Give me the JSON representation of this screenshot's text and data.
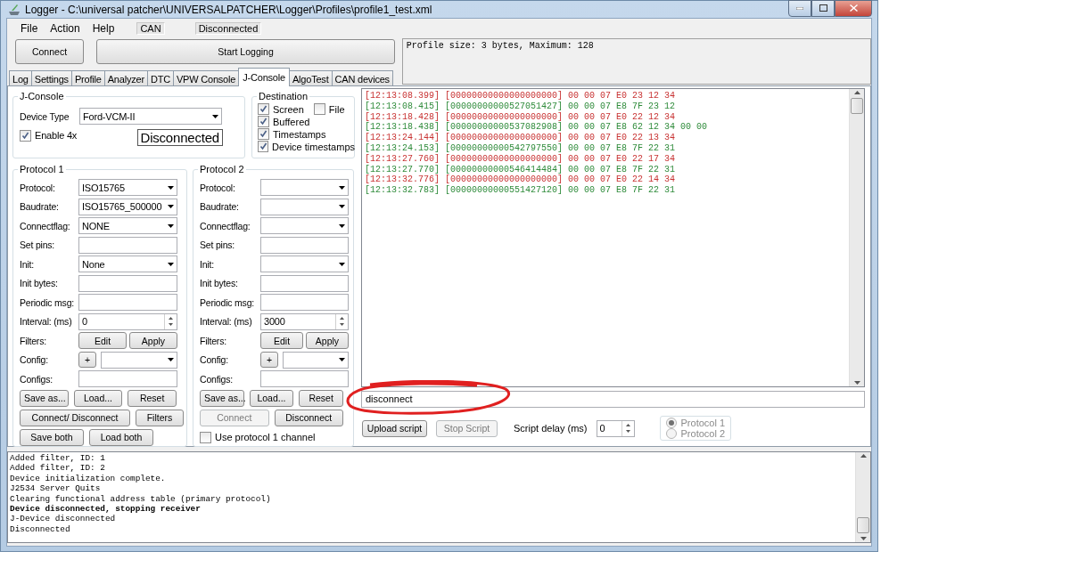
{
  "window": {
    "title": "Logger - C:\\universal patcher\\UNIVERSALPATCHER\\Logger\\Profiles\\profile1_test.xml"
  },
  "menu": [
    "File",
    "Action",
    "Help"
  ],
  "status": {
    "bus": "CAN",
    "connection": "Disconnected"
  },
  "toolbar": {
    "connect": "Connect",
    "start_logging": "Start Logging"
  },
  "info": "Profile size: 3 bytes, Maximum: 128",
  "tabs": [
    {
      "label": "Log",
      "selected": false
    },
    {
      "label": "Settings",
      "selected": false
    },
    {
      "label": "Profile",
      "selected": false
    },
    {
      "label": "Analyzer",
      "selected": false
    },
    {
      "label": "DTC",
      "selected": false
    },
    {
      "label": "VPW Console",
      "selected": false
    },
    {
      "label": "J-Console",
      "selected": true
    },
    {
      "label": "AlgoTest",
      "selected": false
    },
    {
      "label": "CAN devices",
      "selected": false
    }
  ],
  "jconsole": {
    "title": "J-Console",
    "device_type_label": "Device Type",
    "device_type": "Ford-VCM-II",
    "enable4x": {
      "label": "Enable 4x",
      "checked": true
    },
    "status": "Disconnected"
  },
  "destination": {
    "title": "Destination",
    "options": [
      {
        "label": "Screen",
        "checked": true
      },
      {
        "label": "File",
        "checked": false
      },
      {
        "label": "Buffered",
        "checked": true
      },
      {
        "label": "Timestamps",
        "checked": true
      },
      {
        "label": "Device timestamps",
        "checked": true
      }
    ]
  },
  "protocols": [
    {
      "title": "Protocol 1",
      "fields": [
        {
          "kind": "combo",
          "label": "Protocol:",
          "value": "ISO15765"
        },
        {
          "kind": "combo",
          "label": "Baudrate:",
          "value": "ISO15765_500000"
        },
        {
          "kind": "combo",
          "label": "Connectflag:",
          "value": "NONE"
        },
        {
          "kind": "text",
          "label": "Set pins:"
        },
        {
          "kind": "combo",
          "label": "Init:",
          "value": "None"
        },
        {
          "kind": "text",
          "label": "Init bytes:"
        },
        {
          "kind": "text",
          "label": "Periodic msg:"
        },
        {
          "kind": "spin",
          "label": "Interval: (ms)",
          "value": "0"
        },
        {
          "kind": "buttons",
          "label": "Filters:",
          "buttons": [
            {
              "label": "Edit",
              "disabled": false
            },
            {
              "label": "Apply",
              "disabled": false
            }
          ]
        },
        {
          "kind": "config",
          "label": "Config:",
          "button": "+"
        },
        {
          "kind": "text",
          "label": "Configs:"
        }
      ],
      "button_rows": [
        [
          {
            "label": "Save as...",
            "disabled": false
          },
          {
            "label": "Load...",
            "disabled": false
          },
          {
            "label": "Reset",
            "disabled": false
          }
        ],
        [
          {
            "label": "Connect/ Disconnect",
            "disabled": false
          },
          {
            "label": "Filters",
            "disabled": false
          }
        ],
        [
          {
            "label": "Save both",
            "disabled": false
          },
          {
            "label": "Load both",
            "disabled": false
          }
        ]
      ]
    },
    {
      "title": "Protocol 2",
      "fields": [
        {
          "kind": "combo",
          "label": "Protocol:"
        },
        {
          "kind": "combo",
          "label": "Baudrate:"
        },
        {
          "kind": "combo",
          "label": "Connectflag:"
        },
        {
          "kind": "text",
          "label": "Set pins:"
        },
        {
          "kind": "combo",
          "label": "Init:"
        },
        {
          "kind": "text",
          "label": "Init bytes:"
        },
        {
          "kind": "text",
          "label": "Periodic msg:"
        },
        {
          "kind": "spin",
          "label": "Interval: (ms)",
          "value": "3000"
        },
        {
          "kind": "buttons",
          "label": "Filters:",
          "buttons": [
            {
              "label": "Edit",
              "disabled": false
            },
            {
              "label": "Apply",
              "disabled": false
            }
          ]
        },
        {
          "kind": "config",
          "label": "Config:",
          "button": "+"
        },
        {
          "kind": "text",
          "label": "Configs:"
        }
      ],
      "button_rows": [
        [
          {
            "label": "Save as...",
            "disabled": false
          },
          {
            "label": "Load...",
            "disabled": false
          },
          {
            "label": "Reset",
            "disabled": false
          }
        ],
        [
          {
            "label": "Connect",
            "disabled": true
          },
          {
            "label": "Disconnect",
            "disabled": false
          }
        ]
      ],
      "option": {
        "label": "Use protocol 1 channel",
        "checked": false
      }
    }
  ],
  "console": {
    "lines": [
      {
        "text": "[12:13:08.399] [00000000000000000000] 00 00 07 E0 23 12 34",
        "color": "#c83232"
      },
      {
        "text": "[12:13:08.415] [00000000000527051427] 00 00 07 E8 7F 23 12",
        "color": "#2e8b3a"
      },
      {
        "text": "[12:13:18.428] [00000000000000000000] 00 00 07 E0 22 12 34",
        "color": "#c83232"
      },
      {
        "text": "[12:13:18.438] [00000000000537082908] 00 00 07 E8 62 12 34 00 00",
        "color": "#2e8b3a"
      },
      {
        "text": "[12:13:24.144] [00000000000000000000] 00 00 07 E0 22 13 34",
        "color": "#c83232"
      },
      {
        "text": "[12:13:24.153] [00000000000542797550] 00 00 07 E8 7F 22 31",
        "color": "#2e8b3a"
      },
      {
        "text": "[12:13:27.760] [00000000000000000000] 00 00 07 E0 22 17 34",
        "color": "#c83232"
      },
      {
        "text": "[12:13:27.770] [00000000000546414484] 00 00 07 E8 7F 22 31",
        "color": "#2e8b3a"
      },
      {
        "text": "[12:13:32.776] [00000000000000000000] 00 00 07 E0 22 14 34",
        "color": "#c83232"
      },
      {
        "text": "[12:13:32.783] [00000000000551427120] 00 00 07 E8 7F 22 31",
        "color": "#2e8b3a"
      }
    ],
    "command": "disconnect"
  },
  "script": {
    "upload": {
      "label": "Upload script",
      "disabled": false
    },
    "stop": {
      "label": "Stop Script",
      "disabled": true
    },
    "delay_label": "Script delay (ms)",
    "delay": "0",
    "targets": [
      {
        "label": "Protocol 1",
        "selected": true,
        "disabled": true
      },
      {
        "label": "Protocol 2",
        "selected": false,
        "disabled": true
      }
    ]
  },
  "log": [
    {
      "text": "Added filter, ID: 1",
      "bold": false
    },
    {
      "text": "Added filter, ID: 2",
      "bold": false
    },
    {
      "text": "Device initialization complete.",
      "bold": false
    },
    {
      "text": "J2534 Server Quits",
      "bold": false
    },
    {
      "text": "Clearing functional address table (primary protocol)",
      "bold": false
    },
    {
      "text": "Device disconnected, stopping receiver",
      "bold": true
    },
    {
      "text": "J-Device disconnected",
      "bold": false
    },
    {
      "text": "Disconnected",
      "bold": false
    }
  ]
}
